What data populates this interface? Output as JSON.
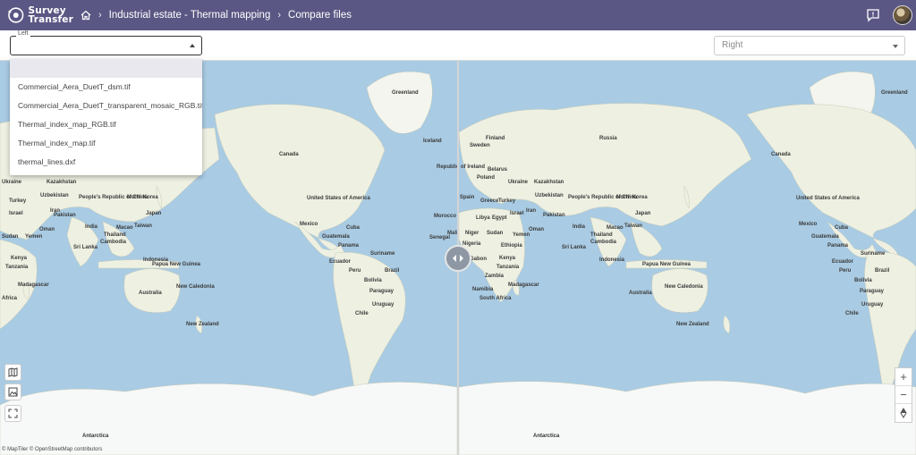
{
  "header": {
    "logo_line1": "Survey",
    "logo_line2": "Transfer",
    "breadcrumbs": [
      "Industrial estate - Thermal mapping",
      "Compare files"
    ]
  },
  "selectors": {
    "left_label": "Left",
    "left_value": "",
    "right_placeholder": "Right"
  },
  "dropdown": {
    "options": [
      "",
      "Commercial_Aera_DuetT_dsm.tif",
      "Commercial_Aera_DuetT_transparent_mosaic_RGB.tif",
      "Thermal_index_map_RGB.tif",
      "Thermal_index_map.tif",
      "thermal_lines.dxf"
    ]
  },
  "map_labels": {
    "left": [
      "Greenland",
      "Iceland",
      "Canada",
      "United States of America",
      "Mexico",
      "Cuba",
      "Guatemala",
      "Panama",
      "Ecuador",
      "Peru",
      "Brazil",
      "Bolivia",
      "Paraguay",
      "Chile",
      "Uruguay",
      "Suriname",
      "Kazakhstan",
      "Uzbekistan",
      "Ukraine",
      "Turkey",
      "Iran",
      "Israel",
      "Pakistan",
      "India",
      "Oman",
      "Yemen",
      "Sudan",
      "Kenya",
      "Tanzania",
      "Madagascar",
      "Sri Lanka",
      "Thailand",
      "Cambodia",
      "Macao",
      "Taiwan",
      "Indonesia",
      "Papua New Guinea",
      "Australia",
      "New Caledonia",
      "New Zealand",
      "People's Republic of China",
      "North Korea",
      "Japan",
      "Antarctica",
      "Africa"
    ],
    "right": [
      "Greenland",
      "Finland",
      "Sweden",
      "Russia",
      "Belarus",
      "Republic of Ireland",
      "Poland",
      "Ukraine",
      "Kazakhstan",
      "Uzbekistan",
      "Spain",
      "Greece",
      "Turkey",
      "Iran",
      "Morocco",
      "Libya",
      "Egypt",
      "Israel",
      "Pakistan",
      "India",
      "Senegal",
      "Mali",
      "Niger",
      "Sudan",
      "Ethiopia",
      "Yemen",
      "Oman",
      "Nigeria",
      "Gabon",
      "Kenya",
      "Tanzania",
      "Zambia",
      "Namibia",
      "Madagascar",
      "South Africa",
      "People's Republic of China",
      "North Korea",
      "Japan",
      "Sri Lanka",
      "Thailand",
      "Cambodia",
      "Macao",
      "Taiwan",
      "Indonesia",
      "Papua New Guinea",
      "Australia",
      "New Caledonia",
      "New Zealand",
      "Canada",
      "United States of America",
      "Mexico",
      "Cuba",
      "Guatemala",
      "Panama",
      "Ecuador",
      "Peru",
      "Brazil",
      "Bolivia",
      "Paraguay",
      "Chile",
      "Uruguay",
      "Suriname",
      "Antarctica"
    ]
  },
  "attribution": "© MapTiler © OpenStreetMap contributors",
  "colors": {
    "header_bg": "#5b5784",
    "ocean": "#a9cbe3",
    "land": "#eef0e2",
    "ice": "#f7f8f8"
  },
  "icons": [
    "home-icon",
    "chevron-right-icon",
    "feedback-icon",
    "caret-up-icon",
    "caret-down-icon",
    "map-layers-icon",
    "image-icon",
    "fullscreen-icon",
    "zoom-in-icon",
    "zoom-out-icon",
    "compass-icon",
    "slider-arrows-icon"
  ]
}
